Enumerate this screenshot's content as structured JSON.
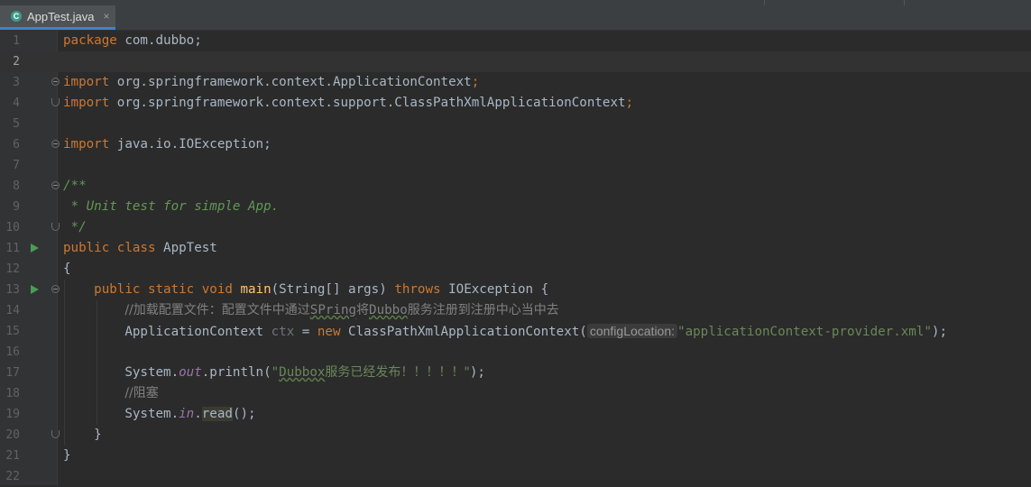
{
  "tab": {
    "label": "AppTest.java",
    "icon": "java-class-icon",
    "close": "×"
  },
  "lines": [
    {
      "n": "1",
      "parts": [
        [
          "kw",
          "package "
        ],
        [
          "",
          "com.dubbo;"
        ]
      ]
    },
    {
      "n": "2",
      "current": true,
      "parts": []
    },
    {
      "n": "3",
      "fold": "start",
      "parts": [
        [
          "kw",
          "import "
        ],
        [
          "",
          "org.springframework.context.ApplicationContext"
        ],
        [
          "kw",
          ";"
        ]
      ]
    },
    {
      "n": "4",
      "fold": "end",
      "parts": [
        [
          "kw",
          "import "
        ],
        [
          "",
          "org.springframework.context.support.ClassPathXmlApplicationContext"
        ],
        [
          "kw",
          ";"
        ]
      ]
    },
    {
      "n": "5",
      "parts": []
    },
    {
      "n": "6",
      "fold": "single",
      "parts": [
        [
          "kw",
          "import "
        ],
        [
          "",
          "java.io.IOException;"
        ]
      ]
    },
    {
      "n": "7",
      "parts": []
    },
    {
      "n": "8",
      "fold": "start",
      "parts": [
        [
          "cm",
          "/**"
        ]
      ]
    },
    {
      "n": "9",
      "parts": [
        [
          "cm",
          " * Unit test for simple App."
        ]
      ]
    },
    {
      "n": "10",
      "fold": "end",
      "parts": [
        [
          "cm",
          " */"
        ]
      ]
    },
    {
      "n": "11",
      "run": true,
      "parts": [
        [
          "kw",
          "public class "
        ],
        [
          "",
          "AppTest"
        ]
      ]
    },
    {
      "n": "12",
      "parts": [
        [
          "",
          "{"
        ]
      ]
    },
    {
      "n": "13",
      "run": true,
      "fold": "start",
      "parts": [
        [
          "",
          "    "
        ],
        [
          "kw",
          "public static void "
        ],
        [
          "fn",
          "main"
        ],
        [
          "",
          "(String[] args) "
        ],
        [
          "kw",
          "throws "
        ],
        [
          "",
          "IOException {"
        ]
      ]
    },
    {
      "n": "14",
      "parts": [
        [
          "",
          "        "
        ],
        [
          "lc",
          "//加载配置文件：配置文件中通过"
        ],
        [
          "lcsq",
          "SPring"
        ],
        [
          "lc",
          "将"
        ],
        [
          "lcsq",
          "Dubbo"
        ],
        [
          "lc",
          "服务注册到注册中心当中去"
        ]
      ]
    },
    {
      "n": "15",
      "parts": [
        [
          "",
          "        ApplicationContext "
        ],
        [
          "unused",
          "ctx"
        ],
        [
          "",
          " = "
        ],
        [
          "kw",
          "new "
        ],
        [
          "",
          "ClassPathXmlApplicationContext("
        ],
        [
          "hint",
          "configLocation:"
        ],
        [
          "str",
          "\"applicationContext-provider.xml\""
        ],
        [
          "",
          ");"
        ]
      ]
    },
    {
      "n": "16",
      "parts": []
    },
    {
      "n": "17",
      "parts": [
        [
          "",
          "        System."
        ],
        [
          "fld",
          "out"
        ],
        [
          "",
          ".println("
        ],
        [
          "str",
          "\""
        ],
        [
          "strsq",
          "Dubbox"
        ],
        [
          "str",
          "服务已经发布！！！！！\""
        ],
        [
          "",
          ");"
        ]
      ]
    },
    {
      "n": "18",
      "parts": [
        [
          "",
          "        "
        ],
        [
          "lc",
          "//阻塞"
        ]
      ]
    },
    {
      "n": "19",
      "parts": [
        [
          "",
          "        System."
        ],
        [
          "fld",
          "in"
        ],
        [
          "",
          "."
        ],
        [
          "hl",
          "read"
        ],
        [
          "",
          "();"
        ]
      ]
    },
    {
      "n": "20",
      "fold": "end",
      "parts": [
        [
          "",
          "    }"
        ]
      ]
    },
    {
      "n": "21",
      "parts": [
        [
          "",
          "}"
        ]
      ]
    },
    {
      "n": "22",
      "parts": []
    }
  ],
  "colors": {
    "background": "#2b2b2b",
    "keyword": "#cc7832",
    "string": "#6a8759",
    "comment": "#629755",
    "function": "#ffc66d",
    "field": "#9876aa"
  }
}
